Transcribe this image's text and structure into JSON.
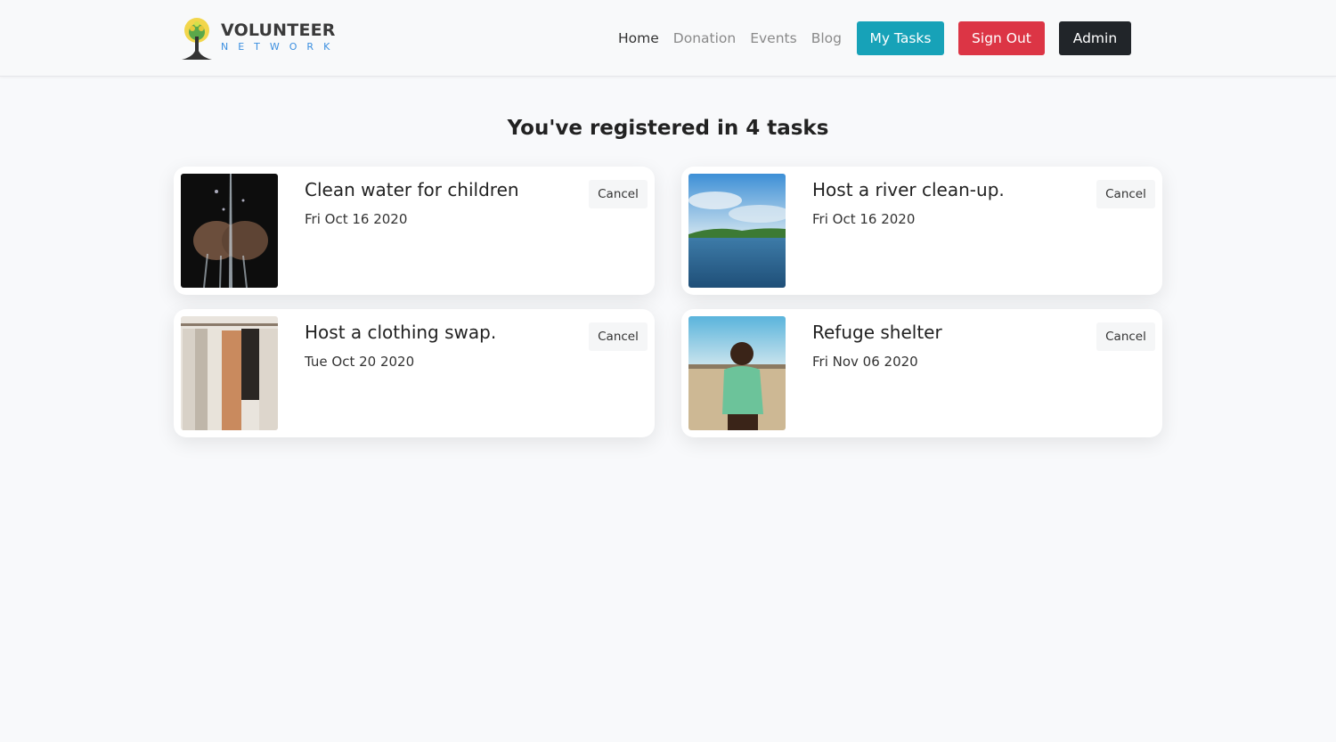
{
  "brand": {
    "title": "VOLUNTEER",
    "subtitle": "NETWORK"
  },
  "nav": {
    "links": [
      {
        "label": "Home",
        "active": true
      },
      {
        "label": "Donation",
        "active": false
      },
      {
        "label": "Events",
        "active": false
      },
      {
        "label": "Blog",
        "active": false
      }
    ],
    "buttons": {
      "my_tasks": "My Tasks",
      "sign_out": "Sign Out",
      "admin": "Admin"
    },
    "colors": {
      "my_tasks": "#17a2b8",
      "sign_out": "#dc3545",
      "admin": "#212529"
    }
  },
  "main": {
    "heading": "You've registered in 4 tasks",
    "tasks": [
      {
        "title": "Clean water for children",
        "date": "Fri Oct 16 2020",
        "cancel_label": "Cancel",
        "image": "hands-water-photo"
      },
      {
        "title": "Host a river clean-up.",
        "date": "Fri Oct 16 2020",
        "cancel_label": "Cancel",
        "image": "river-photo"
      },
      {
        "title": "Host a clothing swap.",
        "date": "Tue Oct 20 2020",
        "cancel_label": "Cancel",
        "image": "clothing-rack-photo"
      },
      {
        "title": "Refuge shelter",
        "date": "Fri Nov 06 2020",
        "cancel_label": "Cancel",
        "image": "child-photo"
      }
    ]
  }
}
